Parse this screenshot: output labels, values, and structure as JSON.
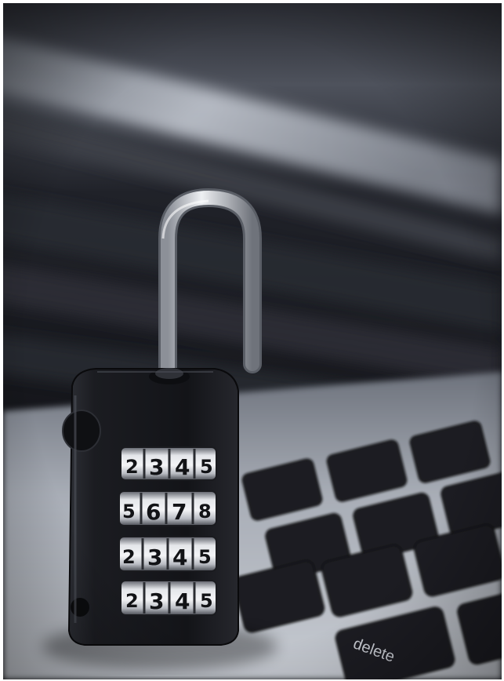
{
  "photo": {
    "subject": "open-combination-padlock-on-laptop-keyboard",
    "colors": {
      "background_dark": "#1a1b20",
      "laptop_silver": "#a9aeb8",
      "lock_body": "#17181c",
      "shackle_steel": "#c4c7cc"
    }
  },
  "padlock": {
    "shackle_state": "open",
    "dials": [
      {
        "digits": [
          "2",
          "3",
          "4",
          "5"
        ]
      },
      {
        "digits": [
          "5",
          "6",
          "7",
          "8"
        ]
      },
      {
        "digits": [
          "2",
          "3",
          "4",
          "5"
        ]
      },
      {
        "digits": [
          "2",
          "3",
          "4",
          "5"
        ]
      }
    ]
  },
  "keyboard": {
    "delete_key_label": "delete"
  }
}
